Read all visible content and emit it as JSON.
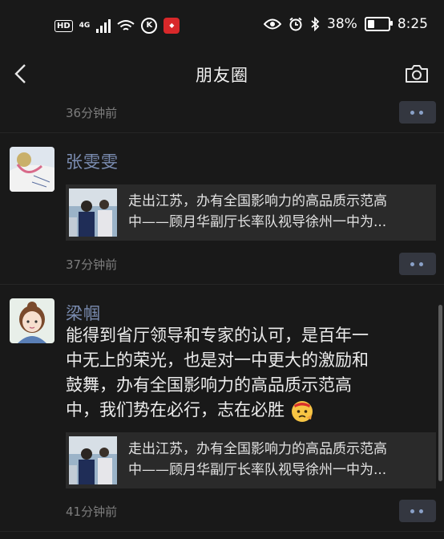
{
  "status_bar": {
    "network": "4G",
    "hd": "HD",
    "k_icon": "K",
    "battery": "38%",
    "battery_level": 0.38,
    "time": "8:25"
  },
  "nav": {
    "title": "朋友圈"
  },
  "feed": {
    "top_time": "36分钟前",
    "posts": [
      {
        "name": "张雯雯",
        "link": {
          "line1": "走出江苏，办有全国影响力的高品质示范高",
          "line2": "中——顾月华副厅长率队视导徐州一中为..."
        },
        "time": "37分钟前"
      },
      {
        "name": "梁帼",
        "text_lines": [
          "能得到省厅领导和专家的认可，是百年一",
          "中无上的荣光，也是对一中更大的激励和",
          "鼓舞，办有全国影响力的高品质示范高",
          "中，我们势在必行，志在必胜"
        ],
        "link": {
          "line1": "走出江苏，办有全国影响力的高品质示范高",
          "line2": "中——顾月华副厅长率队视导徐州一中为..."
        },
        "time": "41分钟前"
      }
    ]
  },
  "colors": {
    "background": "#191919",
    "name": "#7b8db2",
    "time": "#7d7d7d",
    "card": "#2a2a2a"
  }
}
